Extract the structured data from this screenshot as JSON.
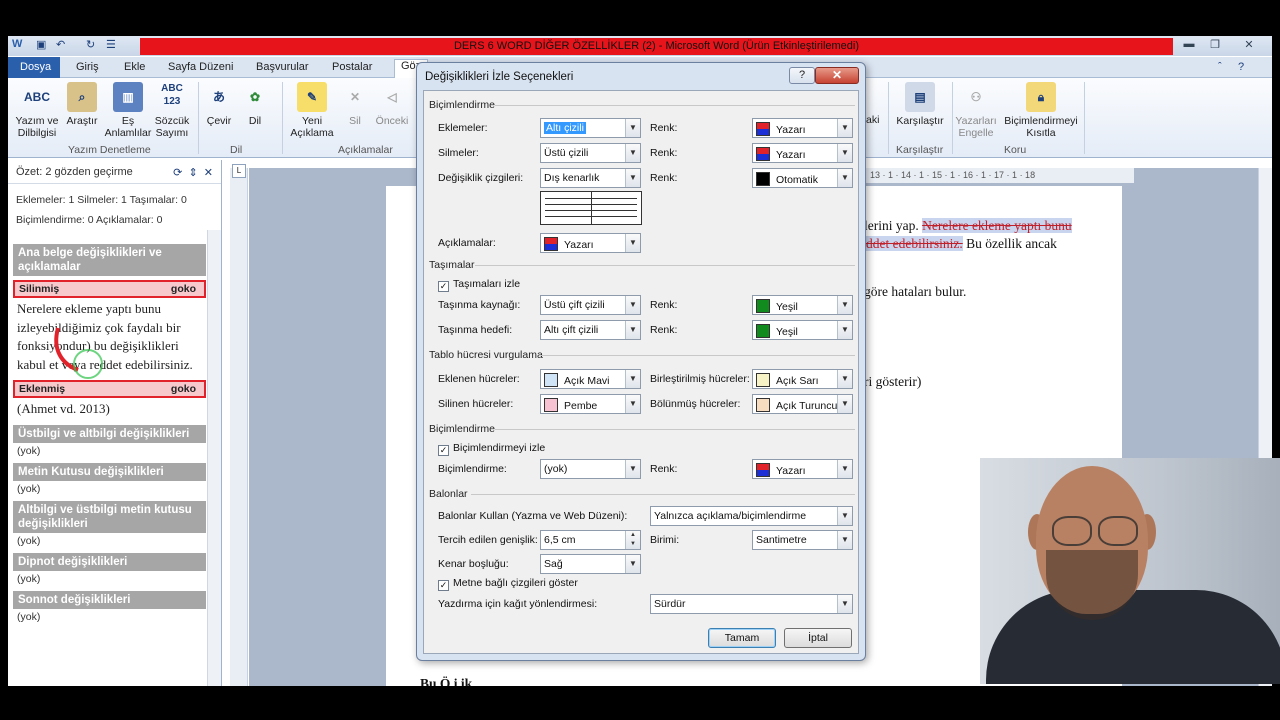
{
  "window": {
    "title": "DERS 6 WORD DİĞER ÖZELLİKLER (2)  -  Microsoft Word (Ürün Etkinleştirilemedi)"
  },
  "tabs": [
    "Dosya",
    "Giriş",
    "Ekle",
    "Sayfa Düzeni",
    "Başvurular",
    "Postalar",
    "Göz"
  ],
  "ribbon": {
    "left_buttons": [
      {
        "label": "Yazım ve\nDilbilgisi",
        "icon": "ABC"
      },
      {
        "label": "Araştır",
        "icon": "book-search-icon"
      },
      {
        "label": "Eş\nAnlamlılar",
        "icon": "thesaurus-icon"
      },
      {
        "label": "Sözcük\nSayımı",
        "icon": "ABC 123"
      },
      {
        "label": "Çevir",
        "icon": "translate-icon"
      },
      {
        "label": "Dil",
        "icon": "language-icon"
      },
      {
        "label": "Yeni\nAçıklama",
        "icon": "new-comment-icon"
      },
      {
        "label": "Sil",
        "icon": "delete-comment-icon"
      },
      {
        "label": "Önceki",
        "icon": "previous-comment-icon"
      }
    ],
    "right_buttons": [
      {
        "label": "Karşılaştır",
        "icon": "compare-icon"
      },
      {
        "label": "Yazarları\nEngelle",
        "icon": "block-authors-icon"
      },
      {
        "label": "Biçimlendirmeyi\nKısıtla",
        "icon": "restrict-editing-icon"
      }
    ],
    "groups": [
      "Yazım Denetleme",
      "Dil",
      "Açıklamalar",
      "Karşılaştır",
      "Koru"
    ],
    "partial_label": "aki"
  },
  "review_pane": {
    "summary": "Özet: 2 gözden geçirme",
    "stats_line1": "Eklemeler: 1  Silmeler: 1  Taşımalar: 0",
    "stats_line2": "Biçimlendirme: 0  Açıklamalar: 0",
    "main_section": "Ana belge değişiklikleri ve açıklamalar",
    "deleted_label": "Silinmiş",
    "deleted_author": "goko",
    "deleted_text": "Nerelere ekleme yaptı bunu izleyebildiğimiz çok faydalı bir fonksiyondur) bu değişiklikleri kabul et veya reddet edebilirsiniz.",
    "inserted_label": "Eklenmiş",
    "inserted_author": "goko",
    "inserted_text": "(Ahmet vd. 2013)",
    "sections": [
      {
        "title": "Üstbilgi ve altbilgi değişiklikleri",
        "value": "(yok)"
      },
      {
        "title": "Metin Kutusu değişiklikleri",
        "value": "(yok)"
      },
      {
        "title": "Altbilgi ve üstbilgi metin kutusu değişiklikleri",
        "value": "(yok)"
      },
      {
        "title": "Dipnot değişiklikleri",
        "value": "(yok)"
      },
      {
        "title": "Sonnot değişiklikleri",
        "value": "(yok)"
      }
    ]
  },
  "document": {
    "line1_prefix": "elerini yap. ",
    "line1_deleted": "Nerelere ekleme yaptı bunu",
    "line2_deleted": "ddet edebilirsiniz.",
    "line2_rest": " Bu özellik ancak",
    "line3": "göre hataları bulur.",
    "line4": "ri gösterir)",
    "bottom_text": "Bu   Ö  i  ik",
    "ruler_text": "13 · 1 · 14 · 1 · 15 · 1 · 16 · 1 · 17 · 1 · 18"
  },
  "dialog": {
    "title": "Değişiklikleri İzle Seçenekleri",
    "help": "?",
    "close": "✕",
    "sections": {
      "formatting": "Biçimlendirme",
      "moves": "Taşımalar",
      "table": "Tablo hücresi vurgulama",
      "formatting2": "Biçimlendirme",
      "balloons": "Balonlar"
    },
    "insertions": {
      "label": "Eklemeler:",
      "value": "Altı çizili",
      "color_label": "Renk:",
      "color": "Yazarı"
    },
    "deletions": {
      "label": "Silmeler:",
      "value": "Üstü çizili",
      "color_label": "Renk:",
      "color": "Yazarı"
    },
    "changed_lines": {
      "label": "Değişiklik çizgileri:",
      "value": "Dış kenarlık",
      "color_label": "Renk:",
      "color": "Otomatik"
    },
    "comments": {
      "label": "Açıklamalar:",
      "color": "Yazarı"
    },
    "track_moves": {
      "label": "Taşımaları izle",
      "checked": true
    },
    "moved_from": {
      "label": "Taşınma kaynağı:",
      "value": "Üstü çift çizili",
      "color_label": "Renk:",
      "color": "Yeşil"
    },
    "moved_to": {
      "label": "Taşınma hedefi:",
      "value": "Altı çift çizili",
      "color_label": "Renk:",
      "color": "Yeşil"
    },
    "inserted_cells": {
      "label": "Eklenen hücreler:",
      "color": "Açık Mavi"
    },
    "merged_cells": {
      "label": "Birleştirilmiş hücreler:",
      "color": "Açık Sarı"
    },
    "deleted_cells": {
      "label": "Silinen hücreler:",
      "color": "Pembe"
    },
    "split_cells": {
      "label": "Bölünmüş hücreler:",
      "color": "Açık Turuncu"
    },
    "track_formatting": {
      "label": "Biçimlendirmeyi izle",
      "checked": true
    },
    "formatting": {
      "label": "Biçimlendirme:",
      "value": "(yok)",
      "color_label": "Renk:",
      "color": "Yazarı"
    },
    "use_balloons": {
      "label": "Balonlar Kullan (Yazma ve Web Düzeni):",
      "value": "Yalnızca açıklama/biçimlendirme"
    },
    "preferred_width": {
      "label": "Tercih edilen genişlik:",
      "value": "6,5 cm"
    },
    "measure_in": {
      "label": "Birimi:",
      "value": "Santimetre"
    },
    "margin": {
      "label": "Kenar boşluğu:",
      "value": "Sağ"
    },
    "show_lines": {
      "label": "Metne bağlı çizgileri göster",
      "checked": true
    },
    "paper_orientation": {
      "label": "Yazdırma için kağıt yönlendirmesi:",
      "value": "Sürdür"
    },
    "ok": "Tamam",
    "cancel": "İptal"
  },
  "colors": {
    "author": [
      "#e2222a",
      "#1c2fd6"
    ],
    "auto": "#000000",
    "green": "#118a1e",
    "light_blue": "#cfe4f7",
    "light_yellow": "#f7f3c6",
    "pink": "#f7c3d3",
    "light_orange": "#f7dcc0",
    "title_red": "#e8141b"
  }
}
